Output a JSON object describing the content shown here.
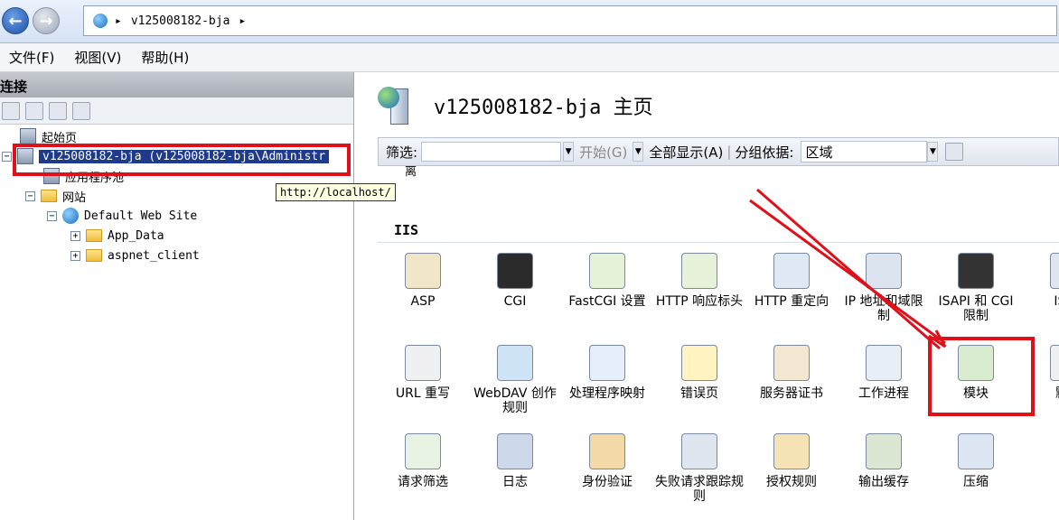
{
  "address": {
    "crumb": "v125008182-bja",
    "sep": "▸"
  },
  "menu": [
    "文件(F)",
    "视图(V)",
    "帮助(H)"
  ],
  "connections": {
    "header": "连接",
    "tree": {
      "start_page": "起始页",
      "server": "v125008182-bja (v125008182-bja\\Administr",
      "app_pools": "应用程序池",
      "sites": "网站",
      "default_site": "Default Web Site",
      "app_data": "App_Data",
      "aspnet_client": "aspnet_client"
    },
    "tooltip": "http://localhost/"
  },
  "main": {
    "title": "v125008182-bja 主页",
    "filter_label": "筛选:",
    "start_label": "开始(G)",
    "show_all": "全部显示(A)",
    "group_by": "分组依据:",
    "group_value": "区域",
    "partial_text": "离",
    "section": "IIS",
    "tiles": [
      {
        "label": "ASP",
        "icon": "asp-icon",
        "color": "#f2e6c9"
      },
      {
        "label": "CGI",
        "icon": "cgi-icon",
        "color": "#2b2b2b"
      },
      {
        "label": "FastCGI 设置",
        "icon": "fastcgi-icon",
        "color": "#e5f2d8"
      },
      {
        "label": "HTTP 响应标头",
        "icon": "http-response-headers-icon",
        "color": "#e8f1d9"
      },
      {
        "label": "HTTP 重定向",
        "icon": "http-redirect-icon",
        "color": "#dfe9f5"
      },
      {
        "label": "IP 地址和域限制",
        "icon": "ip-restrictions-icon",
        "color": "#dbe4ef"
      },
      {
        "label": "ISAPI 和 CGI 限制",
        "icon": "isapi-cgi-restrictions-icon",
        "color": "#333333"
      },
      {
        "label": "ISAP",
        "icon": "isapi-filters-icon",
        "color": "#dfe6f0"
      },
      {
        "label": "URL 重写",
        "icon": "url-rewrite-icon",
        "color": "#eef0f2"
      },
      {
        "label": "WebDAV 创作规则",
        "icon": "webdav-icon",
        "color": "#cfe3f7"
      },
      {
        "label": "处理程序映射",
        "icon": "handler-mappings-icon",
        "color": "#e5eefb"
      },
      {
        "label": "错误页",
        "icon": "error-pages-icon",
        "color": "#fff3c2"
      },
      {
        "label": "服务器证书",
        "icon": "server-certificates-icon",
        "color": "#f3e7d2"
      },
      {
        "label": "工作进程",
        "icon": "worker-processes-icon",
        "color": "#e7eef6"
      },
      {
        "label": "模块",
        "icon": "modules-icon",
        "color": "#d9ecd0"
      },
      {
        "label": "默认",
        "icon": "default-document-icon",
        "color": "#eef0f2"
      },
      {
        "label": "请求筛选",
        "icon": "request-filtering-icon",
        "color": "#e9f3e3"
      },
      {
        "label": "日志",
        "icon": "logging-icon",
        "color": "#cdd9ea"
      },
      {
        "label": "身份验证",
        "icon": "authentication-icon",
        "color": "#f3d9a8"
      },
      {
        "label": "失败请求跟踪规则",
        "icon": "failed-request-tracing-icon",
        "color": "#dfe6f0"
      },
      {
        "label": "授权规则",
        "icon": "authorization-rules-icon",
        "color": "#f6e3b5"
      },
      {
        "label": "输出缓存",
        "icon": "output-caching-icon",
        "color": "#dbe7d3"
      },
      {
        "label": "压缩",
        "icon": "compression-icon",
        "color": "#dce7f3"
      }
    ]
  },
  "accent_red": "#e0101a"
}
